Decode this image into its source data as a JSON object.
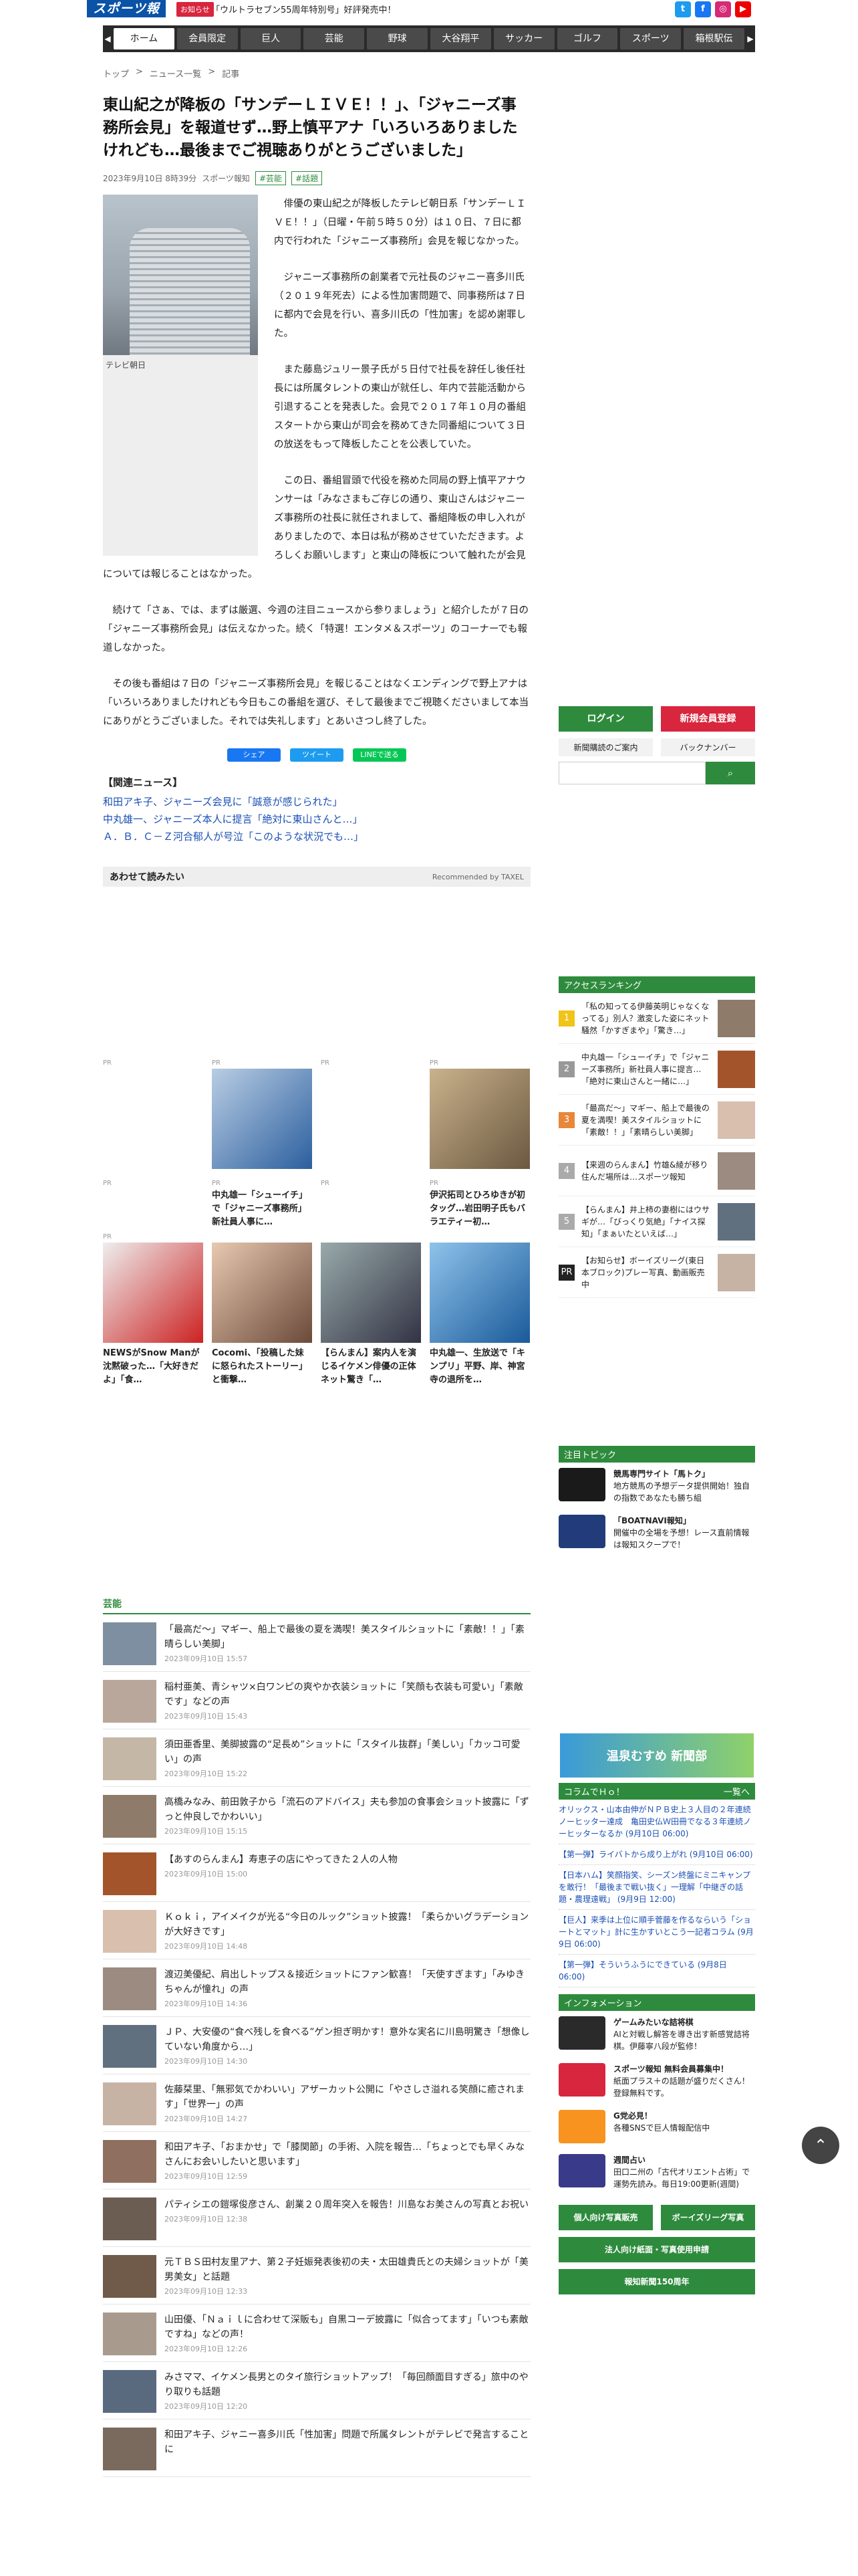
{
  "header": {
    "logo": "スポーツ報知",
    "notice_badge": "お知らせ",
    "notice_text": "「ウルトラセブン55周年特別号」好評発売中！"
  },
  "nav": {
    "items": [
      "ホーム",
      "会員限定",
      "巨人",
      "芸能",
      "野球",
      "大谷翔平",
      "サッカー",
      "ゴルフ",
      "スポーツ",
      "箱根駅伝"
    ],
    "active": 0
  },
  "breadcrumb": [
    "トップ",
    "ニュース一覧",
    "記事"
  ],
  "article": {
    "title": "東山紀之が降板の「サンデーＬＩＶＥ！！」、「ジャニーズ事務所会見」を報道せず…野上慎平アナ「いろいろありましたけれども…最後までご視聴ありがとうございました」",
    "date": "2023年9月10日 8時39分",
    "source": "スポーツ報知",
    "tags": [
      "芸能",
      "話題"
    ],
    "photo_caption": "テレビ朝日",
    "p1": "俳優の東山紀之が降板したテレビ朝日系「サンデーＬＩＶＥ！！」（日曜・午前５時５０分）は１０日、７日に都内で行われた「ジャニーズ事務所」会見を報じなかった。",
    "p2": "ジャニーズ事務所の創業者で元社長のジャニー喜多川氏（２０１９年死去）による性加害問題で、同事務所は７日に都内で会見を行い、喜多川氏の「性加害」を認め謝罪した。",
    "p3": "また藤島ジュリー景子氏が５日付で社長を辞任し後任社長には所属タレントの東山が就任し、年内で芸能活動から引退することを発表した。会見で２０１７年１０月の番組スタートから東山が司会を務めてきた同番組について３日の放送をもって降板したことを公表していた。",
    "p4": "この日、番組冒頭で代役を務めた同局の野上慎平アナウンサーは「みなさまもご存じの通り、東山さんはジャニーズ事務所の社長に就任されまして、番組降板の申し入れがありましたので、本日は私が務めさせていただきます。よろしくお願いします」と東山の降板について触れたが会見については報じることはなかった。",
    "p5": "続けて「さぁ、では、まずは厳選、今週の注目ニュースから参りましょう」と紹介したが７日の「ジャニーズ事務所会見」は伝えなかった。続く「特選！エンタメ＆スポーツ」のコーナーでも報道しなかった。",
    "p6": "その後も番組は７日の「ジャニーズ事務所会見」を報じることはなくエンディングで野上アナは「いろいろありましたけれども今日もこの番組を選び、そして最後までご視聴くださいまして本当にありがとうございました。それでは失礼します」とあいさつし終了した。"
  },
  "share": {
    "facebook": "シェア",
    "twitter": "ツイート",
    "line": "LINEで送る"
  },
  "related": {
    "head": "【関連ニュース】",
    "items": [
      "和田アキ子、ジャニーズ会見に「誠意が感じられた」",
      "中丸雄一、ジャニーズ本人に提言「絶対に東山さんと…」",
      "Ａ．Ｂ．Ｃ－Ｚ河合郁人が号泣「このような状況でも…」"
    ]
  },
  "reco": {
    "title": "あわせて読みたい",
    "by": "Recommended by TAXEL"
  },
  "pr_row1": [
    {
      "label": "PR",
      "text": ""
    },
    {
      "label": "PR",
      "text": ""
    },
    {
      "label": "PR",
      "text": ""
    },
    {
      "label": "PR",
      "text": ""
    }
  ],
  "pr_row2": [
    {
      "label": "PR",
      "text": ""
    },
    {
      "label": "PR",
      "text": "中丸雄一「シューイチ」で「ジャニーズ事務所」新社員人事に…"
    },
    {
      "label": "PR",
      "text": ""
    },
    {
      "label": "PR",
      "text": "伊沢拓司とひろゆきが初タッグ…岩田明子氏もバラエティー初…"
    }
  ],
  "pr_row3": [
    {
      "label": "PR",
      "text": "NEWSがSnow Manが沈黙破った…「大好きだよ」「食…"
    },
    {
      "label": "",
      "text": "Cocomi、「投稿した妹に怒られたストーリー」と衝撃…"
    },
    {
      "label": "",
      "text": "【らんまん】案内人を演じるイケメン俳優の正体 ネット驚き「…"
    },
    {
      "label": "",
      "text": "中丸雄一、生放送で「キンプリ」平野、岸、神宮寺の退所を…"
    }
  ],
  "geino": {
    "head": "芸能",
    "items": [
      {
        "t": "「最高だ〜」マギー、船上で最後の夏を満喫！美スタイルショットに「素敵！！」「素晴らしい美脚」",
        "d": "2023年09月10日 15:57"
      },
      {
        "t": "稲村亜美、青シャツ×白ワンピの爽やか衣装ショットに「笑顔も衣装も可愛い」「素敵です」などの声",
        "d": "2023年09月10日 15:43"
      },
      {
        "t": "須田亜香里、美脚披露の“足長め”ショットに「スタイル抜群」「美しい」「カッコ可愛い」の声",
        "d": "2023年09月10日 15:22"
      },
      {
        "t": "高橋みなみ、前田敦子から「流石のアドバイス」夫も参加の食事会ショット披露に「ずっと仲良しでかわいい」",
        "d": "2023年09月10日 15:15"
      },
      {
        "t": "【あすのらんまん】寿恵子の店にやってきた２人の人物",
        "d": "2023年09月10日 15:00"
      },
      {
        "t": "Ｋｏｋｉ，アイメイクが光る“今日のルック”ショット披露！「柔らかいグラデーションが大好きです」",
        "d": "2023年09月10日 14:48"
      },
      {
        "t": "渡辺美優紀、肩出しトップス＆接近ショットにファン歓喜！「天使すぎます」「みゆきちゃんが憧れ」の声",
        "d": "2023年09月10日 14:36"
      },
      {
        "t": "ＪＰ、大安優の“食べ残しを食べる”ゲン担ぎ明かす！意外な実名に川島明驚き「想像していない角度から…」",
        "d": "2023年09月10日 14:30"
      },
      {
        "t": "佐藤栞里、「無邪気でかわいい」アザーカット公開に「やさしさ溢れる笑顔に癒されます」「世界一」の声",
        "d": "2023年09月10日 14:27"
      },
      {
        "t": "和田アキ子、「おまかせ」で「膝関節」の手術、入院を報告…「ちょっとでも早くみなさんにお会いしたいと思います」",
        "d": "2023年09月10日 12:59"
      },
      {
        "t": "パティシエの鎧塚俊彦さん、創業２０周年突入を報告！川島なお美さんの写真とお祝い",
        "d": "2023年09月10日 12:38"
      },
      {
        "t": "元ＴＢＳ田村友里アナ、第２子妊娠発表後初の夫・太田雄貴氏との夫婦ショットが「美男美女」と話題",
        "d": "2023年09月10日 12:33"
      },
      {
        "t": "山田優、「Ｎａｉｌに合わせて深販も」自黒コーデ披露に「似合ってます」「いつも素敵ですね」などの声！",
        "d": "2023年09月10日 12:26"
      },
      {
        "t": "みさママ、イケメン長男とのタイ旅行ショットアップ！「毎回顔面目すぎる」旅中のやり取りも話題",
        "d": "2023年09月10日 12:20"
      },
      {
        "t": "和田アキ子、ジャニー喜多川氏「性加害」問題で所属タレントがテレビで発言することに",
        "d": ""
      }
    ]
  },
  "side": {
    "login": "ログイン",
    "register": "新規会員登録",
    "subscribe": "新聞購読のご案内",
    "backnumber": "バックナンバー",
    "search_placeholder": "",
    "ranking_head": "アクセスランキング",
    "ranking": [
      {
        "n": "1",
        "t": "「私の知ってる伊藤英明じゃなくなってる」別人？激変した姿にネット騒然「かすぎまや」「驚き…」"
      },
      {
        "n": "2",
        "t": "中丸雄一「シューイチ」で「ジャニーズ事務所」新社員人事に提言…「絶対に東山さんと一緒に…」"
      },
      {
        "n": "3",
        "t": "「最高だ〜」マギー、船上で最後の夏を満喫！美スタイルショットに「素敵！！」「素晴らしい美脚」"
      },
      {
        "n": "4",
        "t": "【来週のらんまん】竹雄&綾が移り住んだ場所は…スポーツ報知"
      },
      {
        "n": "5",
        "t": "【らんまん】井上柿の妻樹にはウサギが…「びっくり気絶」「ナイス探知」「まぁいたといえば…」"
      },
      {
        "n": "PR",
        "t": "【お知らせ】ボーイズリーグ(東日本ブロック)プレー写真、動画販売中"
      }
    ],
    "topics_head": "注目トピック",
    "topics": [
      {
        "h": "競馬専門サイト「馬トク」",
        "t": "地方競馬の予想データ提供開始！独自の指数であなたも勝ち組"
      },
      {
        "h": "「BOATNAVI報知」",
        "t": "開催中の全場を予想！レース直前情報は報知スクープで！"
      }
    ],
    "banner": "温泉むすめ 新聞部",
    "column_head": "コラムでＨｏ！",
    "column_more": "一覧へ",
    "columns": [
      "オリックス・山本由伸がＮＰＢ史上３人目の２年連続ノーヒッター達成　亀田史仏Ｗ田冊でなる３年連続ノーヒッターなるか (9月10日 06:00)",
      "【第一弾】ライバトから成り上がれ (9月10日 06:00)",
      "【日本ハム】笑顔指笑、シーズン終盤にミニキャンプを敢行！「最後まで戦い抜く」一理解「中継ぎの話題・農理遠戦」 (9月9日 12:00)",
      "【巨人】来季は上位に順手菅藤を作るならいう「ショートとマット」計に生かすいとこう一記者コラム (9月9日 06:00)",
      "【第一弾】そういうふうにできている (9月8日 06:00)"
    ],
    "info_head": "インフォメーション",
    "info": [
      {
        "h": "ゲームみたいな詰将棋",
        "t": "AIと対戦し解答を導き出す新感覚詰将棋。伊藤寧八段が監修！"
      },
      {
        "h": "スポーツ報知 無料会員募集中！",
        "t": "紙面プラス＋の話題が盛りだくさん！登録無料です。"
      },
      {
        "h": "G党必見！",
        "t": "各種SNSで巨人情報配信中"
      },
      {
        "h": "週間占い",
        "t": "田口二州の「古代オリエント占術」で運勢先読み。毎日19:00更新(週間)"
      }
    ],
    "btn1": "個人向け写真販売",
    "btn2": "ボーイズリーグ写真",
    "btn3": "法人向け紙面・写真使用申請",
    "btn4": "報知新聞150周年"
  },
  "colors": {
    "brand": "#0a53a6",
    "accent": "#2e8b3d",
    "red": "#d7263d"
  }
}
